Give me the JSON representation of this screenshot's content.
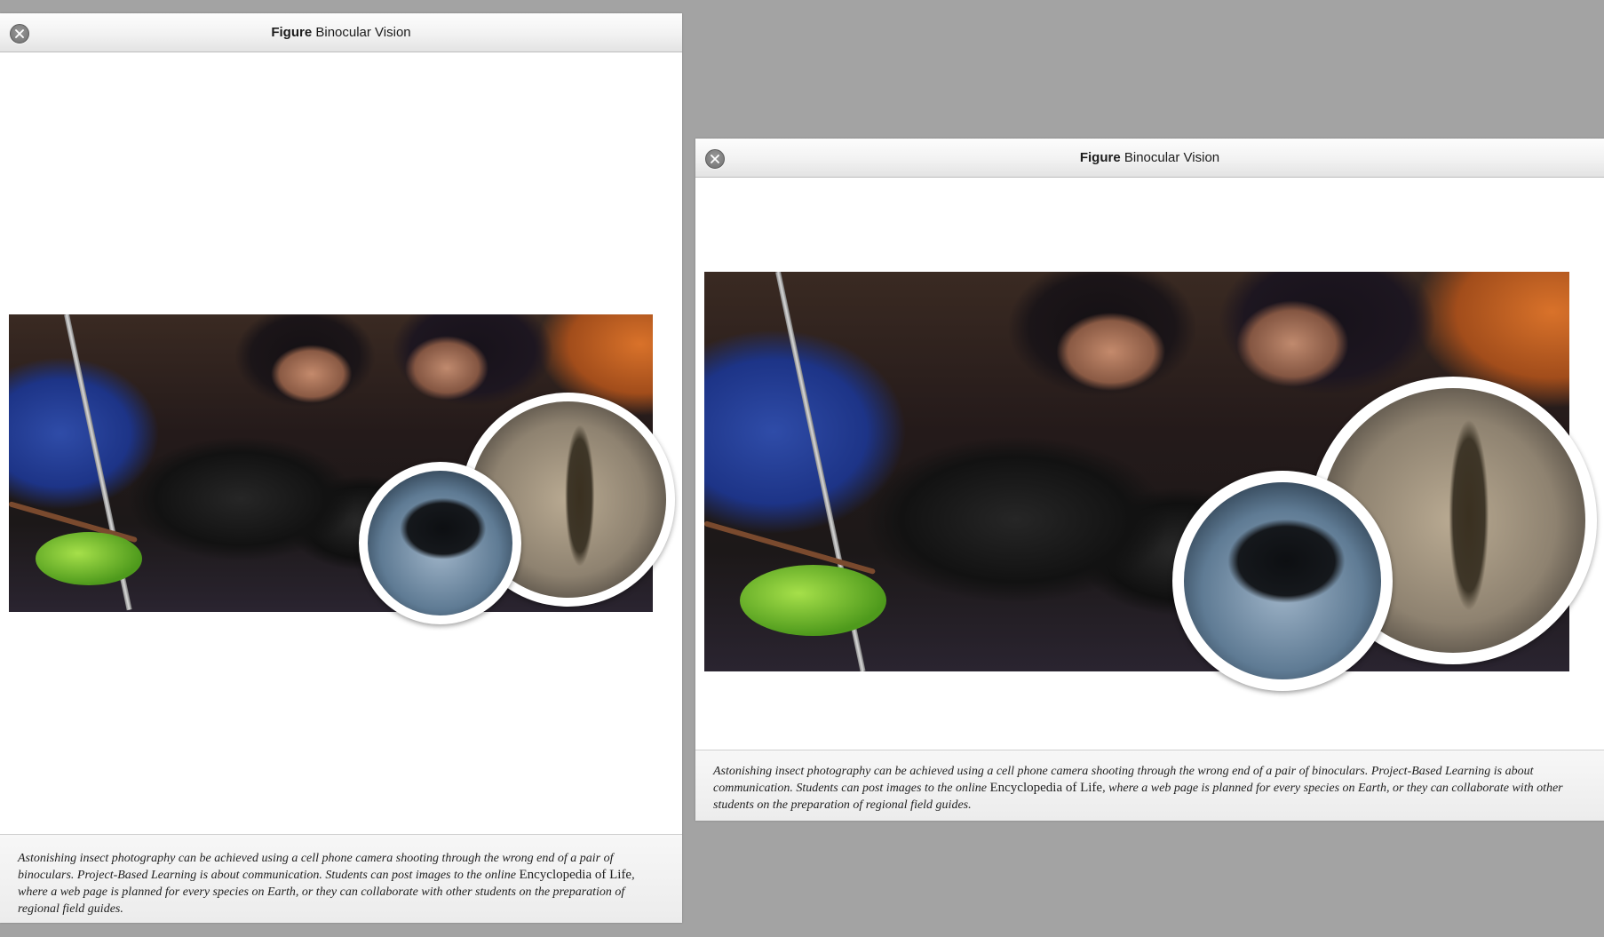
{
  "windows": [
    {
      "title_bold": "Figure",
      "title_rest": "Binocular Vision",
      "caption": {
        "part1": "Astonishing insect photography can be achieved using a cell phone camera shooting through the wrong end of a pair of binoculars. Project-Based Learning is about communication. Students can post images to the online ",
        "link": "Encyclopedia of Life",
        "part2": ", where a web page is planned for every species on Earth, or they can collaborate with other students on the preparation of regional field guides."
      }
    },
    {
      "title_bold": "Figure",
      "title_rest": "Binocular Vision",
      "caption": {
        "part1": "Astonishing insect photography can be achieved using a cell phone camera shooting through the wrong end of a pair of binoculars. Project-Based Learning is about communication. Students can post images to the online ",
        "link": "Encyclopedia of Life",
        "part2": ", where a web page is planned for every species on Earth, or they can collaborate with other students on the preparation of regional field guides."
      }
    }
  ],
  "colors": {
    "background": "#a3a3a3",
    "window": "#ffffff",
    "caption_bg": "#efefef"
  },
  "icons": [
    "close-icon"
  ]
}
